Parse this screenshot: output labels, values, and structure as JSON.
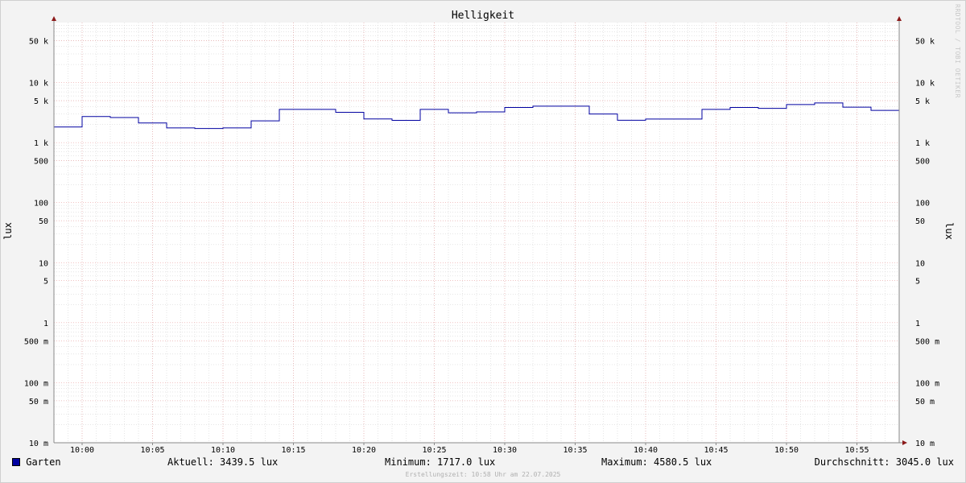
{
  "chart_data": {
    "type": "line",
    "title": "Helligkeit",
    "ylabel": "lux",
    "y_scale": "log",
    "ylim": [
      0.01,
      100000
    ],
    "x_range": [
      "09:58",
      "10:58"
    ],
    "x_ticks": [
      "10:00",
      "10:05",
      "10:10",
      "10:15",
      "10:20",
      "10:25",
      "10:30",
      "10:35",
      "10:40",
      "10:45",
      "10:50",
      "10:55"
    ],
    "y_ticks": [
      {
        "value": 0.01,
        "label": "10 m"
      },
      {
        "value": 0.05,
        "label": "50 m"
      },
      {
        "value": 0.1,
        "label": "100 m"
      },
      {
        "value": 0.5,
        "label": "500 m"
      },
      {
        "value": 1,
        "label": "1"
      },
      {
        "value": 5,
        "label": "5"
      },
      {
        "value": 10,
        "label": "10"
      },
      {
        "value": 50,
        "label": "50"
      },
      {
        "value": 100,
        "label": "100"
      },
      {
        "value": 500,
        "label": "500"
      },
      {
        "value": 1000,
        "label": "1 k"
      },
      {
        "value": 5000,
        "label": "5 k"
      },
      {
        "value": 10000,
        "label": "10 k"
      },
      {
        "value": 50000,
        "label": "50 k"
      }
    ],
    "grid": true,
    "series": [
      {
        "name": "Garten",
        "color": "#0000a0",
        "step": "post",
        "x": [
          "09:58",
          "10:00",
          "10:02",
          "10:04",
          "10:06",
          "10:08",
          "10:10",
          "10:12",
          "10:14",
          "10:16",
          "10:18",
          "10:20",
          "10:22",
          "10:24",
          "10:26",
          "10:28",
          "10:30",
          "10:32",
          "10:34",
          "10:36",
          "10:38",
          "10:40",
          "10:42",
          "10:44",
          "10:46",
          "10:48",
          "10:50",
          "10:52",
          "10:54",
          "10:56"
        ],
        "values": [
          1820,
          2720,
          2620,
          2120,
          1760,
          1717,
          1760,
          2300,
          3570,
          3570,
          3200,
          2480,
          2350,
          3570,
          3140,
          3250,
          3850,
          4050,
          4050,
          2990,
          2360,
          2470,
          2470,
          3570,
          3850,
          3720,
          4310,
          4580,
          3900,
          3440
        ]
      }
    ],
    "legend": {
      "label": "Garten",
      "aktuell": "Aktuell: 3439.5 lux",
      "minimum": "Minimum: 1717.0 lux",
      "maximum": "Maximum: 4580.5 lux",
      "durchschnitt": "Durchschnitt: 3045.0 lux"
    },
    "footer": "Erstellungszeit: 10:58 Uhr am 22.07.2025",
    "watermark": "RRDTOOL / TOBI OETIKER"
  },
  "colors": {
    "background": "#f3f3f3",
    "canvas": "#ffffff",
    "major_grid": "#e9a0a0",
    "minor_grid": "#cccccc",
    "axis_arrow": "#8b1a1a",
    "line": "#0000a0"
  }
}
